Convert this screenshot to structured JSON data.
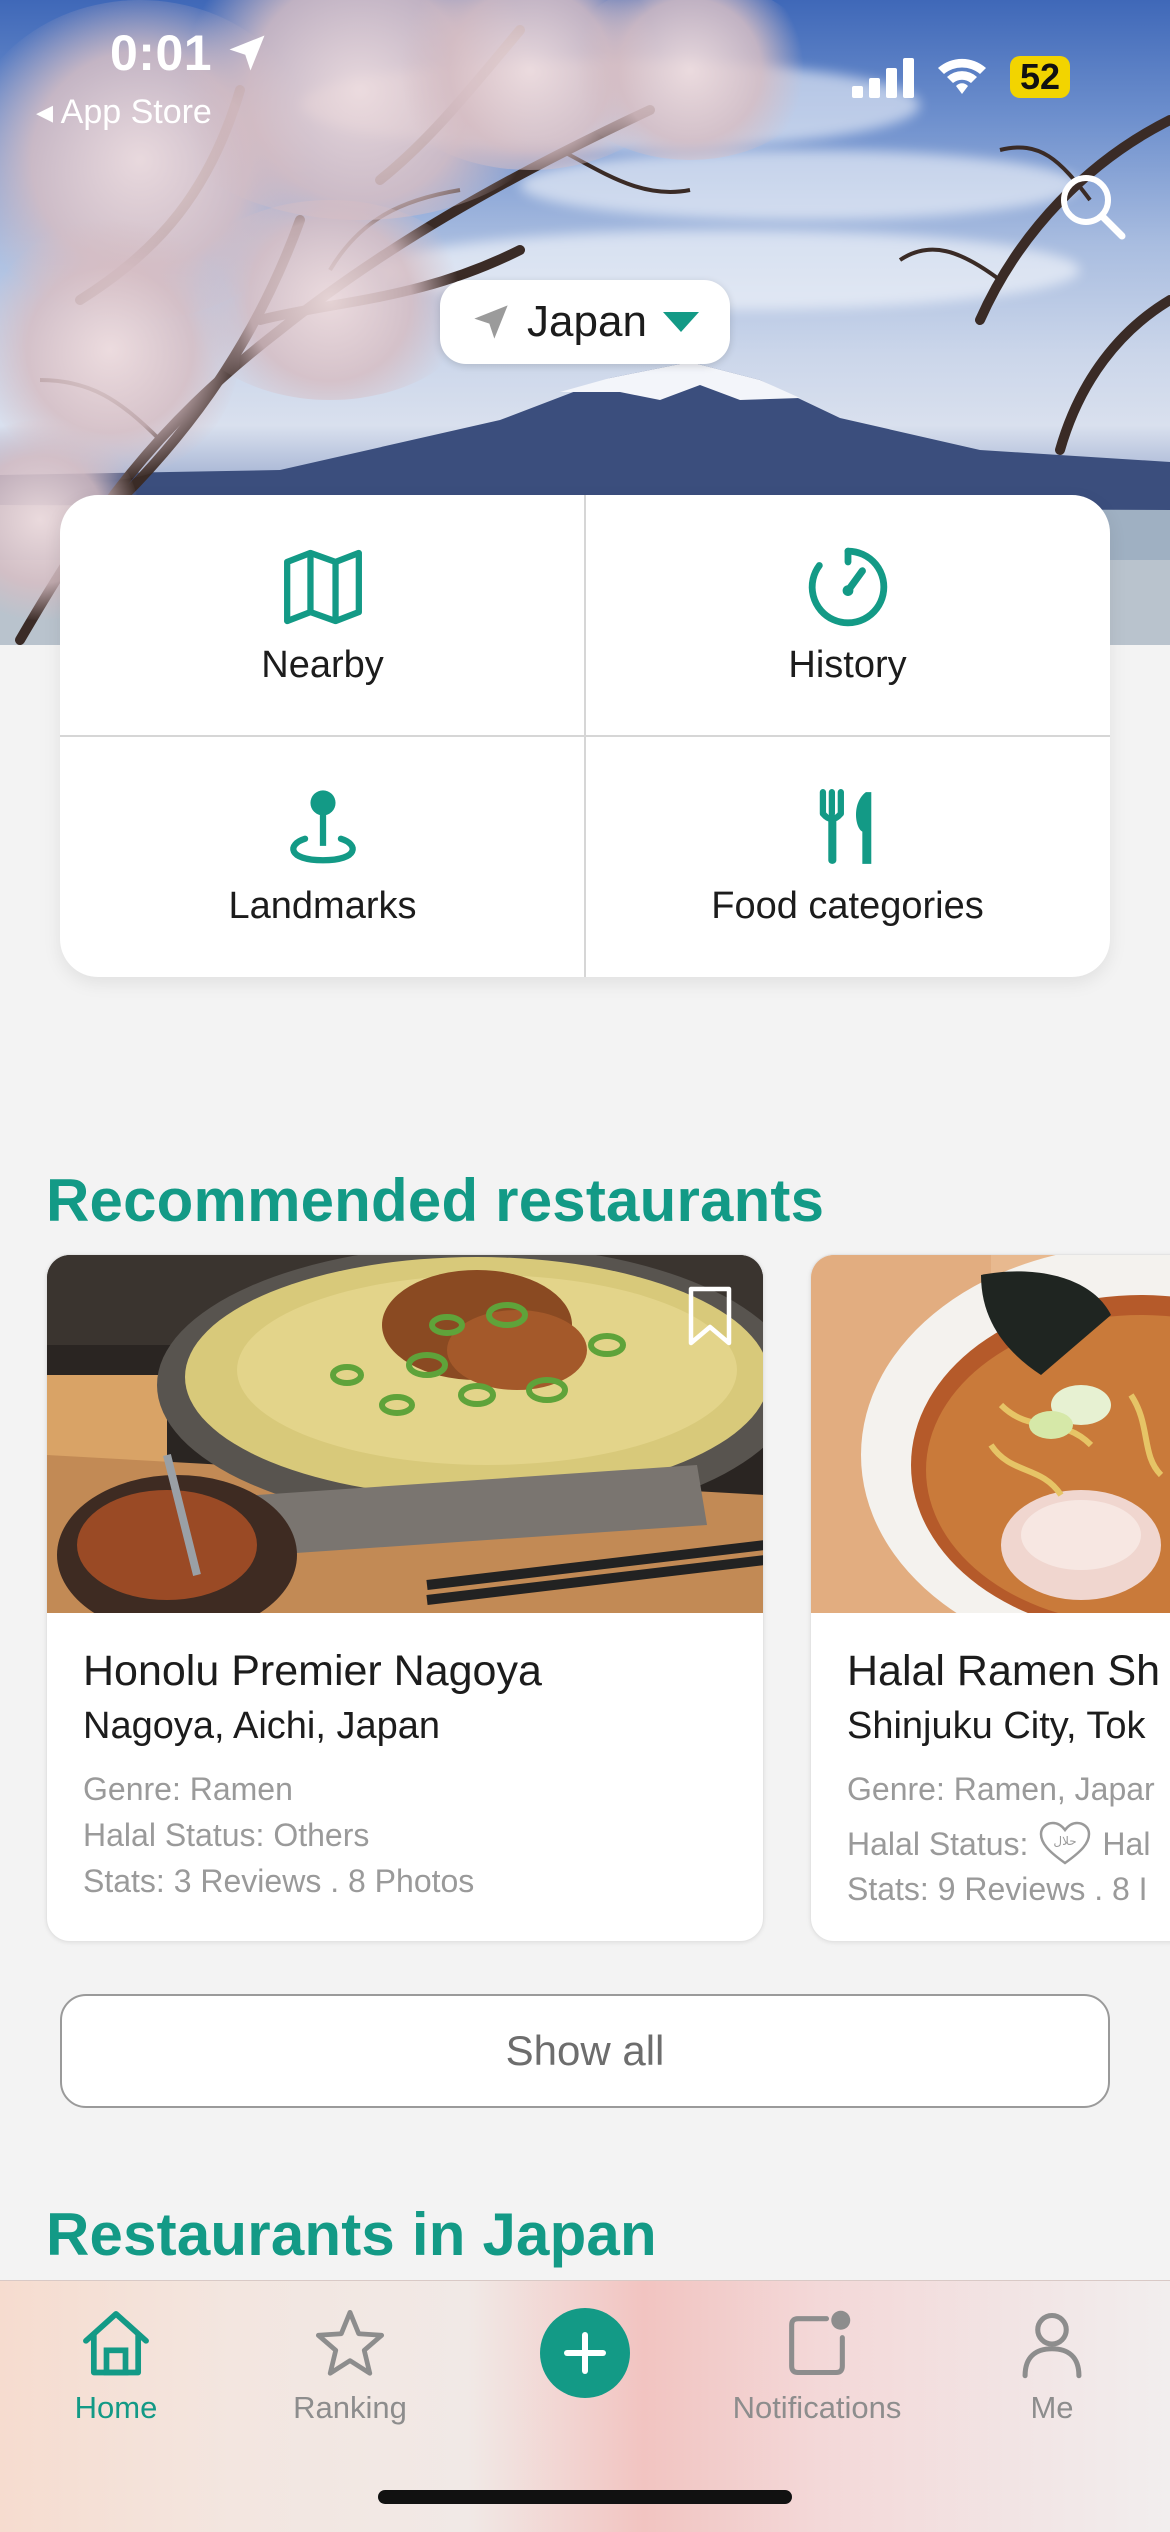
{
  "status_bar": {
    "time": "0:01",
    "back_app": "◂ App Store",
    "battery": "52"
  },
  "hero": {
    "country": "Japan"
  },
  "quick_links": [
    {
      "label": "Nearby",
      "icon": "map-icon"
    },
    {
      "label": "History",
      "icon": "history-icon"
    },
    {
      "label": "Landmarks",
      "icon": "landmark-pin-icon"
    },
    {
      "label": "Food categories",
      "icon": "fork-knife-icon"
    }
  ],
  "recommended": {
    "title": "Recommended restaurants",
    "cards": [
      {
        "name": "Honolu Premier Nagoya",
        "location": "Nagoya, Aichi, Japan",
        "genre": "Genre: Ramen",
        "halal": "Halal Status: Others",
        "stats": "Stats: 3 Reviews . 8 Photos"
      },
      {
        "name": "Halal Ramen Sh",
        "location": "Shinjuku City, Tok",
        "genre": "Genre: Ramen, Japar",
        "halal_prefix": "Halal Status:",
        "halal_suffix": "Hal",
        "stats": "Stats: 9 Reviews . 8 I"
      }
    ],
    "show_all": "Show all"
  },
  "restaurants_section": {
    "title": "Restaurants in Japan"
  },
  "tabbar": {
    "home": "Home",
    "ranking": "Ranking",
    "notifications": "Notifications",
    "me": "Me",
    "active_color": "#139a86",
    "inactive_color": "#8d8d8d"
  },
  "colors": {
    "accent": "#139a86",
    "background": "#f3f3f3"
  }
}
